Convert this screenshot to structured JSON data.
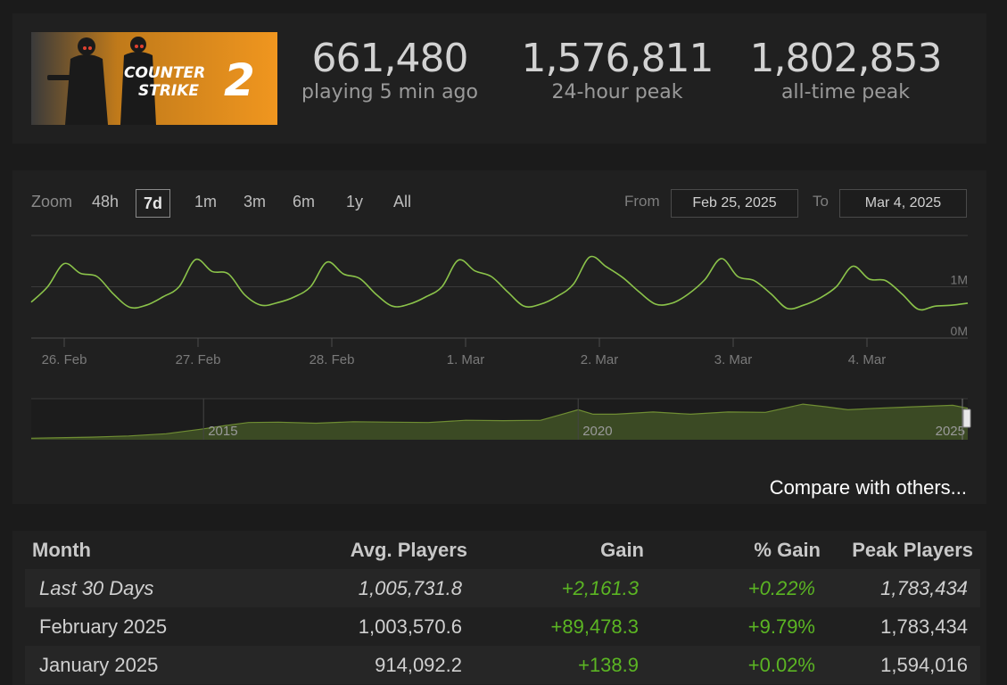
{
  "game": {
    "banner_line1": "COUNTER",
    "banner_line2": "STRIKE",
    "banner_number": "2"
  },
  "stats": [
    {
      "value": "661,480",
      "label": "playing 5 min ago"
    },
    {
      "value": "1,576,811",
      "label": "24-hour peak"
    },
    {
      "value": "1,802,853",
      "label": "all-time peak"
    }
  ],
  "controls": {
    "zoom_label": "Zoom",
    "zoom_options": [
      "48h",
      "7d",
      "1m",
      "3m",
      "6m",
      "1y",
      "All"
    ],
    "zoom_selected": "7d",
    "from_label": "From",
    "from_value": "Feb 25, 2025",
    "to_label": "To",
    "to_value": "Mar 4, 2025"
  },
  "chart_data": [
    {
      "type": "line",
      "title": "",
      "xlabel": "",
      "ylabel": "",
      "x_ticks": [
        "26. Feb",
        "27. Feb",
        "28. Feb",
        "1. Mar",
        "2. Mar",
        "3. Mar",
        "4. Mar"
      ],
      "y_ticks": [
        "0M",
        "1M"
      ],
      "ylim": [
        0,
        2000000
      ],
      "grid": true,
      "series": [
        {
          "color": "#8bc34a",
          "x": [
            "Feb 25 18:00",
            "Feb 25 21:00",
            "Feb 26 00:00",
            "Feb 26 03:00",
            "Feb 26 06:00",
            "Feb 26 09:00",
            "Feb 26 12:00",
            "Feb 26 15:00",
            "Feb 26 18:00",
            "Feb 26 21:00",
            "Feb 27 00:00",
            "Feb 27 03:00",
            "Feb 27 06:00",
            "Feb 27 09:00",
            "Feb 27 12:00",
            "Feb 27 15:00",
            "Feb 27 18:00",
            "Feb 27 21:00",
            "Feb 28 00:00",
            "Feb 28 03:00",
            "Feb 28 06:00",
            "Feb 28 09:00",
            "Feb 28 12:00",
            "Feb 28 15:00",
            "Feb 28 18:00",
            "Feb 28 21:00",
            "Mar 1 00:00",
            "Mar 1 03:00",
            "Mar 1 06:00",
            "Mar 1 09:00",
            "Mar 1 12:00",
            "Mar 1 15:00",
            "Mar 1 18:00",
            "Mar 1 21:00",
            "Mar 2 00:00",
            "Mar 2 03:00",
            "Mar 2 06:00",
            "Mar 2 09:00",
            "Mar 2 12:00",
            "Mar 2 15:00",
            "Mar 2 18:00",
            "Mar 2 21:00",
            "Mar 3 00:00",
            "Mar 3 03:00",
            "Mar 3 06:00",
            "Mar 3 09:00",
            "Mar 3 12:00",
            "Mar 3 15:00",
            "Mar 3 18:00",
            "Mar 3 21:00",
            "Mar 4 00:00",
            "Mar 4 03:00",
            "Mar 4 06:00",
            "Mar 4 09:00",
            "Mar 4 12:00",
            "Mar 4 15:00",
            "Mar 4 18:00",
            "Mar 4 21:00"
          ],
          "values": [
            700000,
            1000000,
            1450000,
            1260000,
            1200000,
            860000,
            600000,
            640000,
            800000,
            1000000,
            1530000,
            1300000,
            1250000,
            840000,
            640000,
            690000,
            800000,
            1000000,
            1480000,
            1250000,
            1160000,
            850000,
            620000,
            660000,
            800000,
            1000000,
            1520000,
            1310000,
            1200000,
            900000,
            620000,
            660000,
            810000,
            1050000,
            1580000,
            1390000,
            1180000,
            900000,
            660000,
            680000,
            860000,
            1140000,
            1550000,
            1200000,
            1120000,
            870000,
            580000,
            640000,
            780000,
            1000000,
            1400000,
            1150000,
            1120000,
            860000,
            560000,
            620000,
            640000,
            680000
          ]
        }
      ]
    },
    {
      "type": "area",
      "title": "",
      "x_ticks": [
        "2015",
        "2020",
        "2025"
      ],
      "series": [
        {
          "color": "#6f8d33",
          "x": [
            2012.7,
            2013,
            2013.5,
            2014,
            2014.5,
            2015,
            2015.3,
            2015.6,
            2016,
            2016.5,
            2017,
            2017.5,
            2018,
            2018.5,
            2019,
            2019.5,
            2020,
            2020.2,
            2020.5,
            2021,
            2021.5,
            2022,
            2022.5,
            2023,
            2023.3,
            2023.6,
            2024,
            2024.5,
            2025,
            2025.2
          ],
          "values": [
            0.04,
            0.05,
            0.07,
            0.1,
            0.16,
            0.29,
            0.38,
            0.46,
            0.47,
            0.44,
            0.48,
            0.47,
            0.46,
            0.52,
            0.51,
            0.52,
            0.8,
            0.68,
            0.68,
            0.74,
            0.68,
            0.74,
            0.73,
            0.95,
            0.88,
            0.8,
            0.84,
            0.88,
            0.92,
            0.84
          ]
        }
      ]
    }
  ],
  "compare_label": "Compare with others...",
  "table": {
    "headers": [
      "Month",
      "Avg. Players",
      "Gain",
      "% Gain",
      "Peak Players"
    ],
    "rows": [
      [
        "Last 30 Days",
        "1,005,731.8",
        "+2,161.3",
        "+0.22%",
        "1,783,434"
      ],
      [
        "February 2025",
        "1,003,570.6",
        "+89,478.3",
        "+9.79%",
        "1,783,434"
      ],
      [
        "January 2025",
        "914,092.2",
        "+138.9",
        "+0.02%",
        "1,594,016"
      ]
    ]
  }
}
